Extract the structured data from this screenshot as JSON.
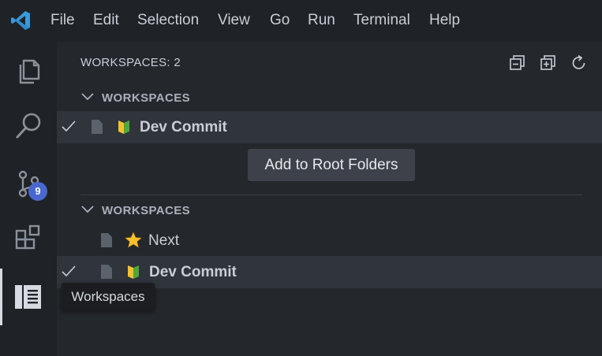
{
  "menu": {
    "items": [
      "File",
      "Edit",
      "Selection",
      "View",
      "Go",
      "Run",
      "Terminal",
      "Help"
    ]
  },
  "activity_bar": {
    "items": [
      {
        "name": "explorer",
        "icon": "files-icon"
      },
      {
        "name": "search",
        "icon": "search-icon"
      },
      {
        "name": "source-control",
        "icon": "source-control-icon",
        "badge": "9"
      },
      {
        "name": "extensions",
        "icon": "extensions-icon"
      },
      {
        "name": "workspaces",
        "icon": "workspaces-icon",
        "active": true
      }
    ],
    "hover_tooltip": "Workspaces"
  },
  "panel": {
    "title": "WORKSPACES: 2",
    "actions": [
      "collapse-all-icon",
      "new-workspace-icon",
      "refresh-icon"
    ],
    "sections": [
      {
        "header": "WORKSPACES",
        "rows": [
          {
            "checked": true,
            "emoji": "beginner-icon",
            "label": "Dev Commit",
            "bold": true,
            "selected": true
          }
        ],
        "hover_button": "Add to Root Folders"
      },
      {
        "header": "WORKSPACES",
        "rows": [
          {
            "checked": false,
            "emoji": "star-icon",
            "label": "Next",
            "bold": false,
            "selected": false
          },
          {
            "checked": true,
            "emoji": "beginner-icon",
            "label": "Dev Commit",
            "bold": true,
            "selected": true
          }
        ]
      }
    ]
  },
  "colors": {
    "background": "#24272c",
    "bars": "#1f2226",
    "selected_row": "#30343b",
    "badge": "#4a68cf",
    "vscode_blue": "#3b99dc"
  }
}
